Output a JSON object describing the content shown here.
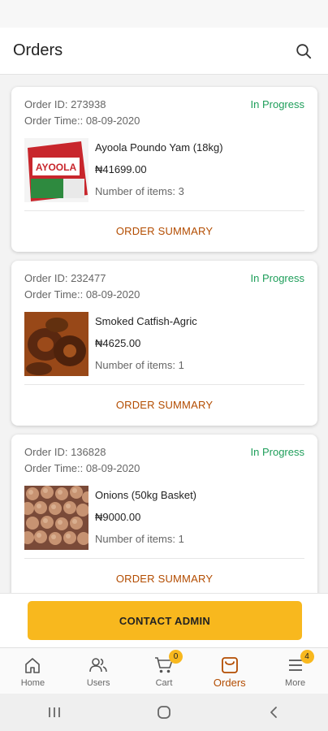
{
  "header": {
    "title": "Orders",
    "search_icon": "search-icon"
  },
  "orders": [
    {
      "id_label": "Order ID: 273938",
      "time_label": "Order Time:: 08-09-2020",
      "status": "In Progress",
      "product_name": "Ayoola Poundo Yam (18kg)",
      "price": "₦41699.00",
      "items_label": "Number of items: 3",
      "summary_label": "ORDER SUMMARY",
      "thumb_logo_text": "AYOOLA"
    },
    {
      "id_label": "Order ID: 232477",
      "time_label": "Order Time:: 08-09-2020",
      "status": "In Progress",
      "product_name": "Smoked Catfish-Agric",
      "price": "₦4625.00",
      "items_label": "Number of items: 1",
      "summary_label": "ORDER SUMMARY"
    },
    {
      "id_label": "Order ID: 136828",
      "time_label": "Order Time:: 08-09-2020",
      "status": "In Progress",
      "product_name": "Onions (50kg Basket)",
      "price": "₦9000.00",
      "items_label": "Number of items: 1",
      "summary_label": "ORDER SUMMARY"
    }
  ],
  "contact_button": "CONTACT ADMIN",
  "nav": {
    "home": "Home",
    "users": "Users",
    "cart": "Cart",
    "cart_badge": "0",
    "orders": "Orders",
    "more": "More",
    "more_badge": "4"
  },
  "colors": {
    "accent": "#f8b81e",
    "status_green": "#1e9e5a",
    "link_brown": "#b34c00"
  }
}
